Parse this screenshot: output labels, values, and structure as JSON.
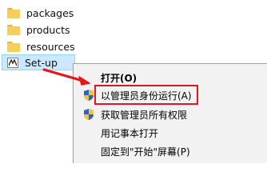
{
  "files": [
    {
      "name": "packages",
      "icon": "folder-icon"
    },
    {
      "name": "products",
      "icon": "folder-icon"
    },
    {
      "name": "resources",
      "icon": "folder-icon"
    },
    {
      "name": "Set-up",
      "icon": "setup-app-icon",
      "selected": true
    }
  ],
  "context_menu": {
    "items": [
      {
        "label": "打开(O)",
        "bold": true,
        "icon": null
      },
      {
        "label": "以管理员身份运行(A)",
        "icon": "uac-shield-icon",
        "highlighted": true
      },
      {
        "label": "获取管理员所有权限",
        "icon": "uac-shield-icon"
      },
      {
        "label": "用记事本打开",
        "icon": null
      },
      {
        "label": "固定到\"开始\"屏幕(P)",
        "icon": null
      },
      {
        "label": "",
        "icon": "uac-shield-icon"
      }
    ]
  },
  "colors": {
    "annotation_red": "#e8141c",
    "selection_fill": "#cce8ff",
    "folder_yellow": "#f6cf5b",
    "menu_background": "#f2f2f2"
  }
}
